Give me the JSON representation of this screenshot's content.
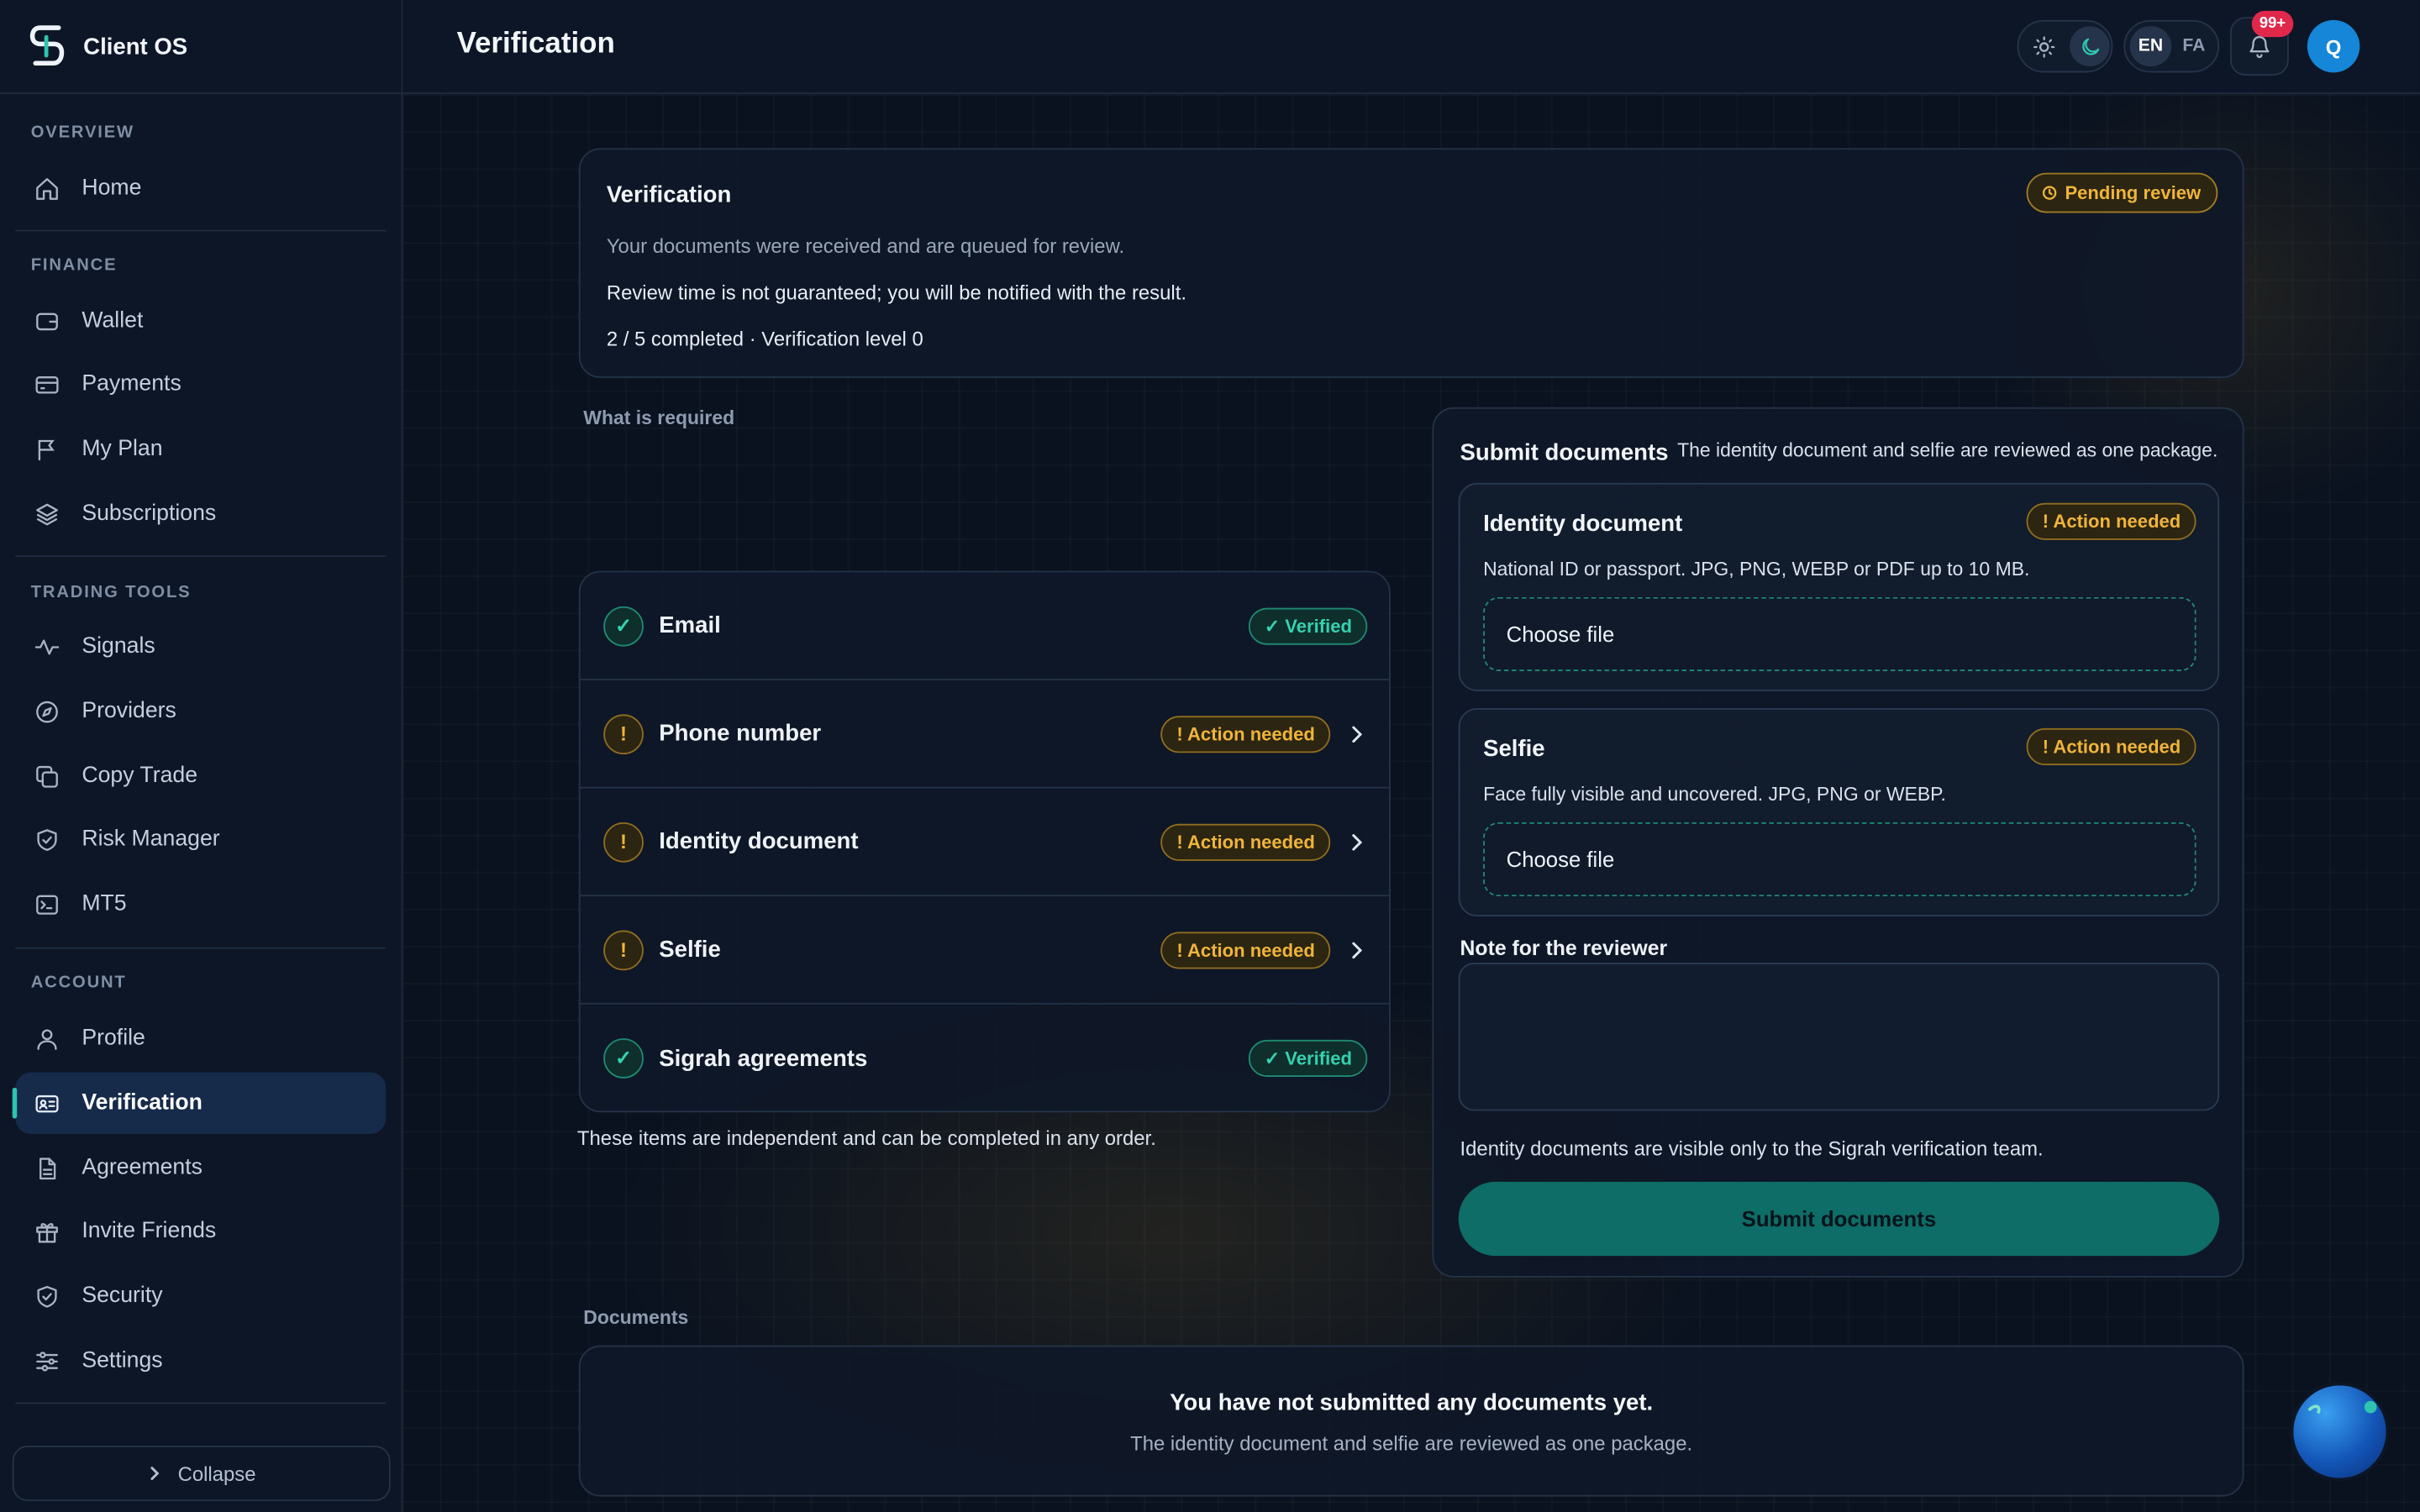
{
  "app": {
    "name": "Client OS"
  },
  "sidebar": {
    "sections": [
      {
        "label": "OVERVIEW"
      },
      {
        "label": "FINANCE"
      },
      {
        "label": "TRADING TOOLS"
      },
      {
        "label": "ACCOUNT"
      }
    ],
    "items": [
      {
        "label": "Home",
        "icon": "home-icon"
      },
      {
        "label": "Wallet",
        "icon": "wallet-icon"
      },
      {
        "label": "Payments",
        "icon": "credit-card-icon"
      },
      {
        "label": "My Plan",
        "icon": "flag-icon"
      },
      {
        "label": "Subscriptions",
        "icon": "layers-icon"
      },
      {
        "label": "Signals",
        "icon": "activity-icon"
      },
      {
        "label": "Providers",
        "icon": "compass-icon"
      },
      {
        "label": "Copy Trade",
        "icon": "copy-icon"
      },
      {
        "label": "Risk Manager",
        "icon": "shield-check-icon"
      },
      {
        "label": "MT5",
        "icon": "terminal-icon"
      },
      {
        "label": "Profile",
        "icon": "user-icon"
      },
      {
        "label": "Verification",
        "icon": "id-card-icon",
        "active": true
      },
      {
        "label": "Agreements",
        "icon": "document-icon"
      },
      {
        "label": "Invite Friends",
        "icon": "gift-icon"
      },
      {
        "label": "Security",
        "icon": "shield-icon"
      },
      {
        "label": "Settings",
        "icon": "sliders-icon"
      }
    ],
    "collapse_label": "Collapse"
  },
  "topbar": {
    "title": "Verification",
    "languages": [
      "EN",
      "FA"
    ],
    "active_language": "EN",
    "theme": "dark",
    "notifications_badge": "99+",
    "avatar_initial": "Q"
  },
  "summary": {
    "title": "Verification",
    "status_badge": "Pending review",
    "line1": "Your documents were received and are queued for review.",
    "line2": "Review time is not guaranteed; you will be notified with the result.",
    "progress": "2 / 5 completed · Verification level 0"
  },
  "requirements": {
    "heading": "What is required",
    "items": [
      {
        "label": "Email",
        "status": "✓ Verified",
        "state": "verified"
      },
      {
        "label": "Phone number",
        "status": "! Action needed",
        "state": "action"
      },
      {
        "label": "Identity document",
        "status": "! Action needed",
        "state": "action"
      },
      {
        "label": "Selfie",
        "status": "! Action needed",
        "state": "action"
      },
      {
        "label": "Sigrah agreements",
        "status": "✓ Verified",
        "state": "verified"
      }
    ],
    "note": "These items are independent and can be completed in any order."
  },
  "submit": {
    "title": "Submit documents",
    "description": "The identity document and selfie are reviewed as one package.",
    "identity": {
      "title": "Identity document",
      "badge": "! Action needed",
      "description": "National ID or passport. JPG, PNG, WEBP or PDF up to 10 MB.",
      "file_label": "Choose file"
    },
    "selfie": {
      "title": "Selfie",
      "badge": "! Action needed",
      "description": "Face fully visible and uncovered. JPG, PNG or WEBP.",
      "file_label": "Choose file"
    },
    "note_label": "Note for the reviewer",
    "note_value": "",
    "privacy": "Identity documents are visible only to the Sigrah verification team.",
    "button": "Submit documents"
  },
  "documents": {
    "heading": "Documents",
    "empty_title": "You have not submitted any documents yet.",
    "empty_sub": "The identity document and selfie are reviewed as one package."
  },
  "colors": {
    "accent": "#2fc4ae",
    "warning": "#f0b43a",
    "success": "#36d1b0",
    "danger": "#e0284a",
    "background": "#0a1220"
  }
}
